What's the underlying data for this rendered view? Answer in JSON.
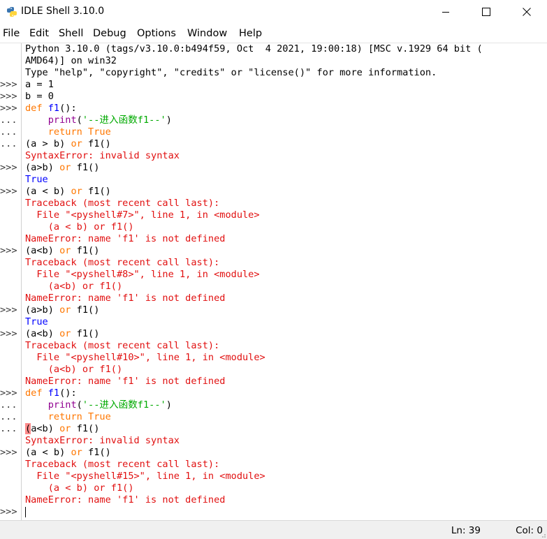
{
  "window": {
    "title": "IDLE Shell 3.10.0",
    "app_icon": "python-icon",
    "controls": [
      "minimize-icon",
      "maximize-icon",
      "close-icon"
    ]
  },
  "menu": [
    "File",
    "Edit",
    "Shell",
    "Debug",
    "Options",
    "Window",
    "Help"
  ],
  "colors": {
    "keyword": "#ff7700",
    "builtin": "#900090",
    "string": "#00aa00",
    "definition": "#0000ff",
    "stdout": "#0000ff",
    "error": "#e11010",
    "error_mark": "#ff8a8a"
  },
  "shell": {
    "lines": [
      {
        "prompt": "",
        "parts": [
          {
            "t": "Python 3.10.0 (tags/v3.10.0:b494f59, Oct  4 2021, 19:00:18) [MSC v.1929 64 bit (",
            "c": "out"
          }
        ]
      },
      {
        "prompt": "",
        "parts": [
          {
            "t": "AMD64)] on win32",
            "c": "out"
          }
        ]
      },
      {
        "prompt": "",
        "parts": [
          {
            "t": "Type \"help\", \"copyright\", \"credits\" or \"license()\" for more information.",
            "c": "out"
          }
        ]
      },
      {
        "prompt": ">>>",
        "parts": [
          {
            "t": "a = 1",
            "c": "in"
          }
        ]
      },
      {
        "prompt": ">>>",
        "parts": [
          {
            "t": "b = 0",
            "c": "in"
          }
        ]
      },
      {
        "prompt": ">>>",
        "parts": [
          {
            "t": "def",
            "c": "kw"
          },
          {
            "t": " ",
            "c": "in"
          },
          {
            "t": "f1",
            "c": "def"
          },
          {
            "t": "():",
            "c": "in"
          }
        ]
      },
      {
        "prompt": "...",
        "parts": [
          {
            "t": "    ",
            "c": "in"
          },
          {
            "t": "print",
            "c": "bi"
          },
          {
            "t": "(",
            "c": "in"
          },
          {
            "t": "'--进入函数f1--'",
            "c": "str"
          },
          {
            "t": ")",
            "c": "in"
          }
        ]
      },
      {
        "prompt": "...",
        "parts": [
          {
            "t": "    ",
            "c": "in"
          },
          {
            "t": "return",
            "c": "kw"
          },
          {
            "t": " ",
            "c": "in"
          },
          {
            "t": "True",
            "c": "kw"
          }
        ]
      },
      {
        "prompt": "...",
        "parts": [
          {
            "t": "(a > b) ",
            "c": "in"
          },
          {
            "t": "or",
            "c": "kw"
          },
          {
            "t": " f1()",
            "c": "in"
          }
        ]
      },
      {
        "prompt": "",
        "parts": [
          {
            "t": "SyntaxError: invalid syntax",
            "c": "err"
          }
        ]
      },
      {
        "prompt": ">>>",
        "parts": [
          {
            "t": "(a>b) ",
            "c": "in"
          },
          {
            "t": "or",
            "c": "kw"
          },
          {
            "t": " f1()",
            "c": "in"
          }
        ]
      },
      {
        "prompt": "",
        "parts": [
          {
            "t": "True",
            "c": "std"
          }
        ]
      },
      {
        "prompt": ">>>",
        "parts": [
          {
            "t": "(a < b) ",
            "c": "in"
          },
          {
            "t": "or",
            "c": "kw"
          },
          {
            "t": " f1()",
            "c": "in"
          }
        ]
      },
      {
        "prompt": "",
        "parts": [
          {
            "t": "Traceback (most recent call last):",
            "c": "err"
          }
        ]
      },
      {
        "prompt": "",
        "parts": [
          {
            "t": "  File \"<pyshell#7>\", line 1, in <module>",
            "c": "err"
          }
        ]
      },
      {
        "prompt": "",
        "parts": [
          {
            "t": "    (a < b) or f1()",
            "c": "err"
          }
        ]
      },
      {
        "prompt": "",
        "parts": [
          {
            "t": "NameError: name 'f1' is not defined",
            "c": "err"
          }
        ]
      },
      {
        "prompt": ">>>",
        "parts": [
          {
            "t": "(a<b) ",
            "c": "in"
          },
          {
            "t": "or",
            "c": "kw"
          },
          {
            "t": " f1()",
            "c": "in"
          }
        ]
      },
      {
        "prompt": "",
        "parts": [
          {
            "t": "Traceback (most recent call last):",
            "c": "err"
          }
        ]
      },
      {
        "prompt": "",
        "parts": [
          {
            "t": "  File \"<pyshell#8>\", line 1, in <module>",
            "c": "err"
          }
        ]
      },
      {
        "prompt": "",
        "parts": [
          {
            "t": "    (a<b) or f1()",
            "c": "err"
          }
        ]
      },
      {
        "prompt": "",
        "parts": [
          {
            "t": "NameError: name 'f1' is not defined",
            "c": "err"
          }
        ]
      },
      {
        "prompt": ">>>",
        "parts": [
          {
            "t": "(a>b) ",
            "c": "in"
          },
          {
            "t": "or",
            "c": "kw"
          },
          {
            "t": " f1()",
            "c": "in"
          }
        ]
      },
      {
        "prompt": "",
        "parts": [
          {
            "t": "True",
            "c": "std"
          }
        ]
      },
      {
        "prompt": ">>>",
        "parts": [
          {
            "t": "(a<b) ",
            "c": "in"
          },
          {
            "t": "or",
            "c": "kw"
          },
          {
            "t": " f1()",
            "c": "in"
          }
        ]
      },
      {
        "prompt": "",
        "parts": [
          {
            "t": "Traceback (most recent call last):",
            "c": "err"
          }
        ]
      },
      {
        "prompt": "",
        "parts": [
          {
            "t": "  File \"<pyshell#10>\", line 1, in <module>",
            "c": "err"
          }
        ]
      },
      {
        "prompt": "",
        "parts": [
          {
            "t": "    (a<b) or f1()",
            "c": "err"
          }
        ]
      },
      {
        "prompt": "",
        "parts": [
          {
            "t": "NameError: name 'f1' is not defined",
            "c": "err"
          }
        ]
      },
      {
        "prompt": ">>>",
        "parts": [
          {
            "t": "def",
            "c": "kw"
          },
          {
            "t": " ",
            "c": "in"
          },
          {
            "t": "f1",
            "c": "def"
          },
          {
            "t": "():",
            "c": "in"
          }
        ]
      },
      {
        "prompt": "...",
        "parts": [
          {
            "t": "    ",
            "c": "in"
          },
          {
            "t": "print",
            "c": "bi"
          },
          {
            "t": "(",
            "c": "in"
          },
          {
            "t": "'--进入函数f1--'",
            "c": "str"
          },
          {
            "t": ")",
            "c": "in"
          }
        ]
      },
      {
        "prompt": "...",
        "parts": [
          {
            "t": "    ",
            "c": "in"
          },
          {
            "t": "return",
            "c": "kw"
          },
          {
            "t": " ",
            "c": "in"
          },
          {
            "t": "True",
            "c": "kw"
          }
        ]
      },
      {
        "prompt": "...",
        "parts": [
          {
            "t": "(",
            "c": "mark"
          },
          {
            "t": "a<b) ",
            "c": "in"
          },
          {
            "t": "or",
            "c": "kw"
          },
          {
            "t": " f1()",
            "c": "in"
          }
        ]
      },
      {
        "prompt": "",
        "parts": [
          {
            "t": "SyntaxError: invalid syntax",
            "c": "err"
          }
        ]
      },
      {
        "prompt": ">>>",
        "parts": [
          {
            "t": "(a < b) ",
            "c": "in"
          },
          {
            "t": "or",
            "c": "kw"
          },
          {
            "t": " f1()",
            "c": "in"
          }
        ]
      },
      {
        "prompt": "",
        "parts": [
          {
            "t": "Traceback (most recent call last):",
            "c": "err"
          }
        ]
      },
      {
        "prompt": "",
        "parts": [
          {
            "t": "  File \"<pyshell#15>\", line 1, in <module>",
            "c": "err"
          }
        ]
      },
      {
        "prompt": "",
        "parts": [
          {
            "t": "    (a < b) or f1()",
            "c": "err"
          }
        ]
      },
      {
        "prompt": "",
        "parts": [
          {
            "t": "NameError: name 'f1' is not defined",
            "c": "err"
          }
        ]
      },
      {
        "prompt": ">>>",
        "parts": [],
        "cursor": true
      }
    ]
  },
  "status": {
    "line": "Ln: 39",
    "col": "Col: 0"
  }
}
